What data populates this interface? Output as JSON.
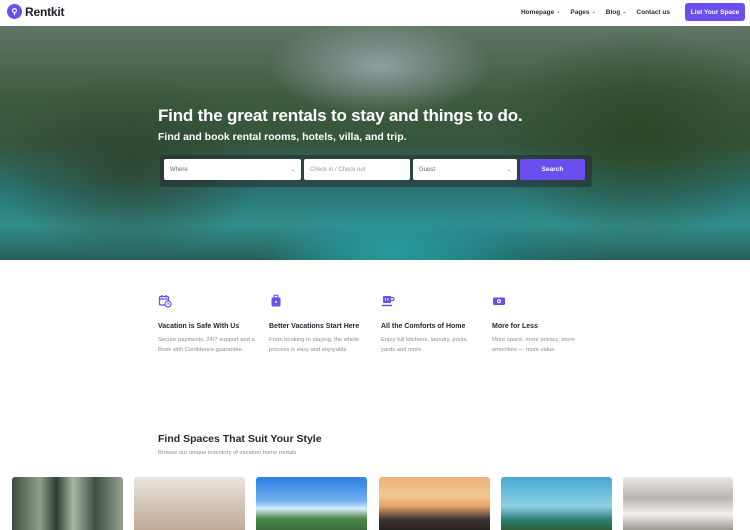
{
  "brand": {
    "name": "Rentkit",
    "accent": "#6b4ef0"
  },
  "nav": {
    "items": [
      {
        "label": "Homepage",
        "has_dropdown": true
      },
      {
        "label": "Pages",
        "has_dropdown": true
      },
      {
        "label": "Blog",
        "has_dropdown": true
      },
      {
        "label": "Contact us",
        "has_dropdown": false
      }
    ],
    "cta_label": "List Your Space"
  },
  "hero": {
    "title": "Find the great rentals to stay and things to do.",
    "subtitle": "Find and book rental rooms, hotels, villa, and trip.",
    "search": {
      "where_placeholder": "Where",
      "dates_placeholder": "Check in / Check out",
      "guest_placeholder": "Guest",
      "button_label": "Search"
    }
  },
  "features": [
    {
      "icon": "calendar-clock-icon",
      "title": "Vacation is Safe With Us",
      "desc": "Secure payments, 24/7 support and a Book with Confidence guarantee."
    },
    {
      "icon": "suitcase-icon",
      "title": "Better Vacations Start Here",
      "desc": "From booking to staying, the whole process is easy and enjoyable"
    },
    {
      "icon": "coffee-cup-icon",
      "title": "All the Comforts of Home",
      "desc": "Enjoy full kitchens, laundry, pools, yards and more"
    },
    {
      "icon": "money-icon",
      "title": "More for Less",
      "desc": "More space, more privacy, more amenities — more value"
    }
  ],
  "spaces": {
    "title": "Find Spaces That Suit Your Style",
    "subtitle": "Browse our unique inventory of vacation home rentals"
  }
}
